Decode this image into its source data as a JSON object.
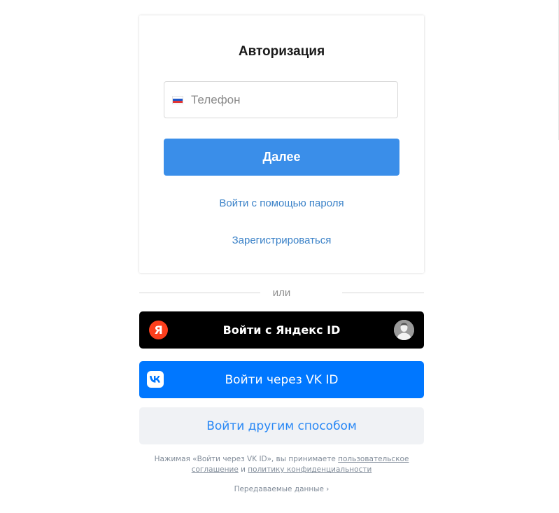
{
  "auth": {
    "title": "Авторизация",
    "phone_placeholder": "Телефон",
    "next_label": "Далее",
    "password_link": "Войти с помощью пароля",
    "register_link": "Зарегистрироваться"
  },
  "divider": {
    "text": "или"
  },
  "yandex": {
    "label": "Войти с Яндекс ID",
    "logo_letter": "Я",
    "logo_icon": "yandex-logo-icon",
    "avatar_icon": "user-avatar-icon"
  },
  "vk": {
    "label": "Войти через VK ID",
    "logo_icon": "vk-logo-icon"
  },
  "other": {
    "label": "Войти другим способом"
  },
  "legal": {
    "prefix": "Нажимая «Войти через VK ID», вы принимаете ",
    "agreement_link": "пользовательское соглашение",
    "conjunction": " и ",
    "privacy_link": "политику конфиденциальности"
  },
  "shared_data": {
    "label": "Передаваемые данные",
    "chevron_icon": "chevron-right-icon"
  },
  "colors": {
    "primary_blue": "#3a8ee9",
    "link_blue": "#3b82c8",
    "vk_blue": "#0077ff",
    "yandex_red": "#fc3f1d",
    "yandex_bg": "#000000",
    "other_bg": "#f0f2f5",
    "other_text": "#2787f5"
  }
}
